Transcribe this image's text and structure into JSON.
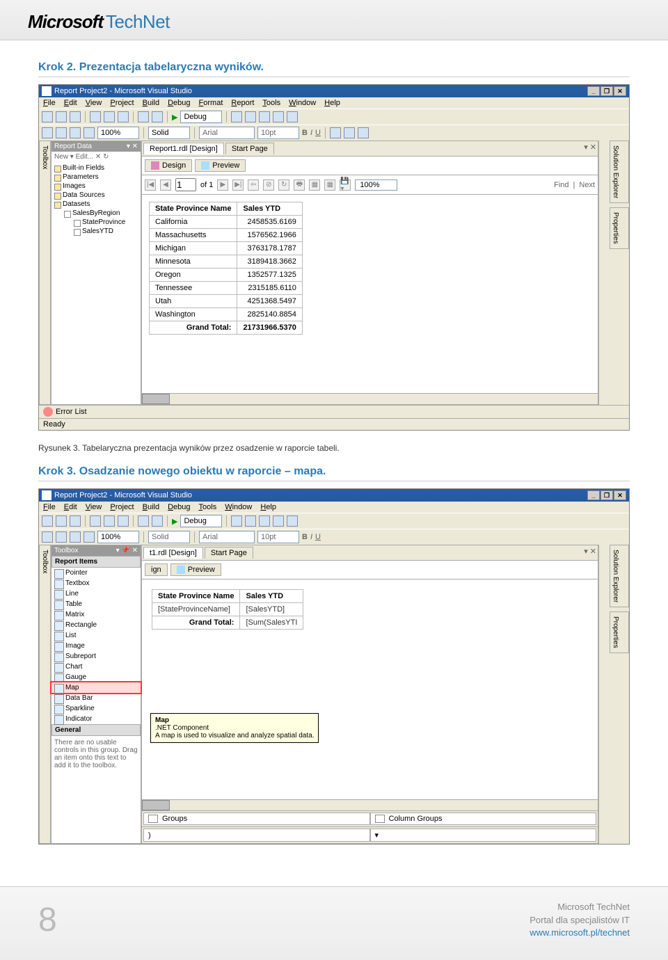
{
  "header": {
    "brand_ms": "Microsoft",
    "brand_tn": "TechNet"
  },
  "section1": {
    "title": "Krok 2. Prezentacja tabelaryczna wyników."
  },
  "shot1": {
    "title": "Report Project2 - Microsoft Visual Studio",
    "menu": [
      "File",
      "Edit",
      "View",
      "Project",
      "Build",
      "Debug",
      "Format",
      "Report",
      "Tools",
      "Window",
      "Help"
    ],
    "config": "Debug",
    "zoom_pct": "100%",
    "line_style": "Solid",
    "font_name": "Arial",
    "font_size": "10pt",
    "left_pane": {
      "title": "Report Data",
      "tools": "New ▾  Edit...  ✕  ↻",
      "tree": [
        "Built-in Fields",
        "Parameters",
        "Images",
        "Data Sources",
        "Datasets"
      ],
      "dataset": "SalesByRegion",
      "fields": [
        "StateProvince",
        "SalesYTD"
      ]
    },
    "tabs": {
      "active": "Report1.rdl [Design]",
      "start": "Start Page"
    },
    "subtabs": {
      "design": "Design",
      "preview": "Preview"
    },
    "nav": {
      "page_idx": "1",
      "of": "of 1",
      "zoom": "100%",
      "find": "Find",
      "next": "Next"
    },
    "table": {
      "headers": [
        "State Province Name",
        "Sales YTD"
      ],
      "rows": [
        [
          "California",
          "2458535.6169"
        ],
        [
          "Massachusetts",
          "1576562.1966"
        ],
        [
          "Michigan",
          "3763178.1787"
        ],
        [
          "Minnesota",
          "3189418.3662"
        ],
        [
          "Oregon",
          "1352577.1325"
        ],
        [
          "Tennessee",
          "2315185.6110"
        ],
        [
          "Utah",
          "4251368.5497"
        ],
        [
          "Washington",
          "2825140.8854"
        ]
      ],
      "total_label": "Grand Total:",
      "total_value": "21731966.5370"
    },
    "error_list": "Error List",
    "status": "Ready",
    "side_tabs": {
      "toolbox": "Toolbox",
      "solution": "Solution Explorer",
      "properties": "Properties"
    }
  },
  "caption1": "Rysunek 3. Tabelaryczna prezentacja wyników przez osadzenie w raporcie tabeli.",
  "section2": {
    "title": "Krok 3. Osadzanie nowego obiektu w raporcie – mapa."
  },
  "shot2": {
    "title": "Report Project2 - Microsoft Visual Studio",
    "menu": [
      "File",
      "Edit",
      "View",
      "Project",
      "Build",
      "Debug",
      "Tools",
      "Window",
      "Help"
    ],
    "config": "Debug",
    "zoom_pct": "100%",
    "line_style": "Solid",
    "font_name": "Arial",
    "font_size": "10pt",
    "toolbox": {
      "title": "Toolbox",
      "section1": "Report Items",
      "items": [
        "Pointer",
        "Textbox",
        "Line",
        "Table",
        "Matrix",
        "Rectangle",
        "List",
        "Image",
        "Subreport",
        "Chart",
        "Gauge",
        "Map",
        "Data Bar",
        "Sparkline",
        "Indicator"
      ],
      "selected": "Map",
      "tooltip_title": "Map",
      "tooltip_sub": ".NET Component",
      "tooltip_desc": "A map is used to visualize and analyze spatial data.",
      "section2": "General",
      "note": "There are no usable controls in this group. Drag an item onto this text to add it to the toolbox."
    },
    "tabs": {
      "active": "t1.rdl [Design]",
      "start": "Start Page"
    },
    "subtabs": {
      "design_short": "ign",
      "preview": "Preview"
    },
    "design_table": {
      "headers": [
        "State Province Name",
        "Sales YTD"
      ],
      "row": [
        "[StateProvinceName]",
        "[SalesYTD]"
      ],
      "total_label": "Grand Total:",
      "total_expr": "[Sum(SalesYTI"
    },
    "groups": {
      "row": "Groups",
      "col": "Column Groups"
    },
    "side_tabs": {
      "toolbox": "Toolbox",
      "solution": "Solution Explorer",
      "properties": "Properties"
    }
  },
  "footer": {
    "page": "8",
    "line1": "Microsoft TechNet",
    "line2": "Portal dla specjalistów IT",
    "url": "www.microsoft.pl/technet"
  }
}
